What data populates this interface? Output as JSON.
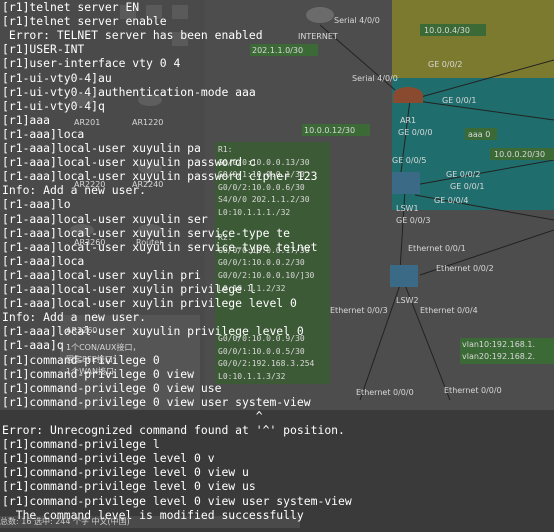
{
  "terminal": {
    "lines": [
      "[r1]telnet server EN",
      "[r1]telnet server enable",
      " Error: TELNET server has been enabled",
      "[r1]USER-INT",
      "[r1]user-interface vty 0 4",
      "[r1-ui-vty0-4]au",
      "[r1-ui-vty0-4]authentication-mode aaa",
      "[r1-ui-vty0-4]q",
      "[r1]aaa",
      "[r1-aaa]loca",
      "[r1-aaa]local-user xuyulin pa",
      "[r1-aaa]local-user xuyulin password c",
      "[r1-aaa]local-user xuyulin password cipher 123",
      "Info: Add a new user.",
      "[r1-aaa]lo",
      "[r1-aaa]local-user xuyulin ser",
      "[r1-aaa]local-user xuyulin service-type te",
      "[r1-aaa]local-user xuyulin service-type telnet",
      "[r1-aaa]loca",
      "[r1-aaa]local-user xuylin pri",
      "[r1-aaa]local-user xuylin privilege l",
      "[r1-aaa]local-user xuylin privilege level 0",
      "Info: Add a new user.",
      "[r1-aaa]local-user xuyulin privilege level 0",
      "[r1-aaa]q",
      "[r1]command-privilege 0",
      "[r1]command-privilege 0 view",
      "[r1]command-privilege 0 view use",
      "[r1]command-privilege 0 view user system-view",
      "                                     ^",
      "Error: Unrecognized command found at '^' position.",
      "[r1]command-privilege l",
      "[r1]command-privilege level 0 v",
      "[r1]command-privilege level 0 view u",
      "[r1]command-privilege level 0 view us",
      "[r1]command-privilege level 0 view user system-view",
      "  The command level is modified successfully"
    ]
  },
  "topology": {
    "internet_label": "INTERNET",
    "serial_400": "Serial 4/0/0",
    "serial_400b": "Serial 4/0/0",
    "net_202": "202.1.1.0/30",
    "net_10_4": "10.0.0.4/30",
    "ge_002": "GE 0/0/2",
    "ge_001": "GE 0/0/1",
    "ar1": "AR1",
    "ge_000": "GE 0/0/0",
    "net_10_12": "10.0.0.12/30",
    "aaa_label": "aaa 0",
    "net_10_20": "10.0.0.20/30",
    "ge_005": "GE 0/0/5",
    "ge_002b": "GE 0/0/2",
    "ge_001b": "GE 0/0/1",
    "ge_004": "GE 0/0/4",
    "lsw1": "LSW1",
    "ge_003": "GE 0/0/3",
    "eth_001": "Ethernet 0/0/1",
    "eth_002": "Ethernet 0/0/2",
    "lsw2": "LSW2",
    "eth_003": "Ethernet 0/0/3",
    "eth_004": "Ethernet 0/0/4",
    "eth_000": "Ethernet 0/0/0",
    "eth_000b": "Ethernet 0/0/0",
    "vlan10": "vlan10:192.168.1.",
    "vlan20": "vlan20:192.168.2.",
    "r1_info": [
      "R1:",
      "G0/0/0:10.0.0.13/30",
      "G0/0/1:10.0.0.1/30",
      "G0/0/2:10.0.0.6/30",
      "S4/0/0 202.1.1.2/30",
      "L0:10.1.1.1./32",
      "",
      "R2:",
      "G0/0/0:10.0.0.17/30",
      "G0/0/1:10.0.0.2/30",
      "G0/0/2:10.0.0.10/]30",
      "L0:10.1.1.2/32",
      "",
      "",
      "",
      "G0/0/0:10.0.0.9/30",
      "G0/0/1:10.0.0.5/30",
      "G0/0/2:192.168.3.254",
      "L0:10.1.1.3/32"
    ],
    "palette": {
      "ar201": "AR201",
      "ar1220": "AR1220",
      "ar2220": "AR2220",
      "ar2240": "AR2240",
      "ar3260": "AR3260",
      "router": "Router",
      "ar3260_b": "AR3260",
      "desc1": "1个CON/AUX接口，",
      "desc2": "固定8FE接口，",
      "desc3": "1个WAN接口"
    }
  },
  "statusbar": {
    "text": "总数: 16 选中: 244 个字  中文(中国)"
  },
  "colors": {
    "terminal_text": "#ffffff",
    "overlay": "#000000",
    "yellow_zone": "#b9b53a",
    "teal_zone": "#2aa5a5",
    "label_green": "#3f7f3a"
  }
}
